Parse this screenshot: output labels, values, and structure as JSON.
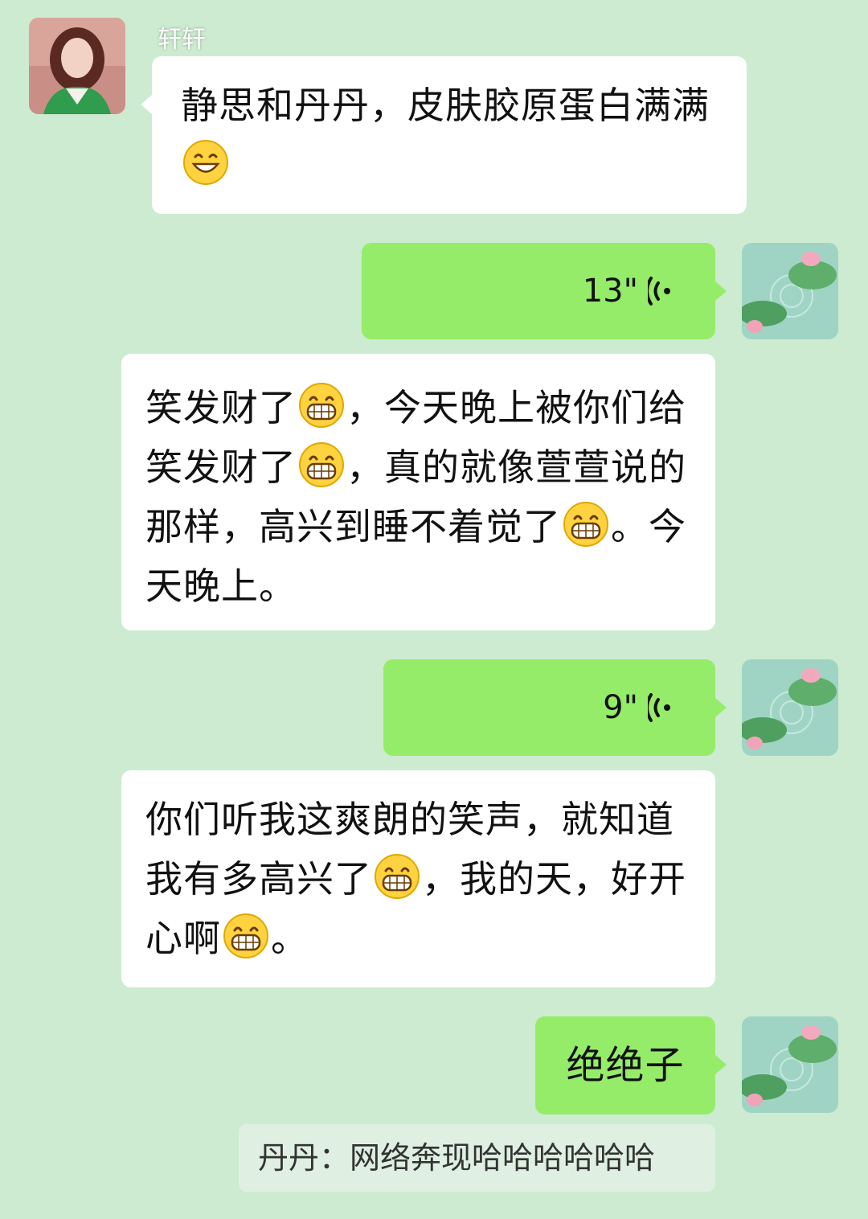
{
  "chat": {
    "messages": [
      {
        "id": "m1",
        "direction": "incoming",
        "sender": "轩轩",
        "avatar": "woman-portrait-avatar",
        "type": "text",
        "text": "静思和丹丹，皮肤胶原蛋白满满😄"
      },
      {
        "id": "m2",
        "direction": "outgoing",
        "avatar": "lotus-pond-avatar",
        "type": "voice",
        "duration": "13\""
      },
      {
        "id": "m3",
        "direction": "incoming",
        "type": "text",
        "text": "笑发财了😁，今天晚上被你们给笑发财了😁，真的就像萱萱说的那样，高兴到睡不着觉了😁。今天晚上。"
      },
      {
        "id": "m4",
        "direction": "outgoing",
        "avatar": "lotus-pond-avatar",
        "type": "voice",
        "duration": "9\""
      },
      {
        "id": "m5",
        "direction": "incoming",
        "type": "text",
        "text": "你们听我这爽朗的笑声，就知道我有多高兴了😁，我的天，好开心啊😁。"
      },
      {
        "id": "m6",
        "direction": "outgoing",
        "avatar": "lotus-pond-avatar",
        "type": "text",
        "text": "绝绝子"
      }
    ],
    "quote": {
      "text": "丹丹：网络奔现哈哈哈哈哈哈"
    }
  },
  "colors": {
    "background": "#cdebd1",
    "incoming_bubble": "#ffffff",
    "outgoing_bubble": "#95ec69",
    "quote_background": "#dff0e2"
  },
  "icons": {
    "voice": "voice-wave-icon",
    "smile_emoji": "smiling-face-emoji",
    "grin_emoji": "grinning-face-emoji"
  }
}
